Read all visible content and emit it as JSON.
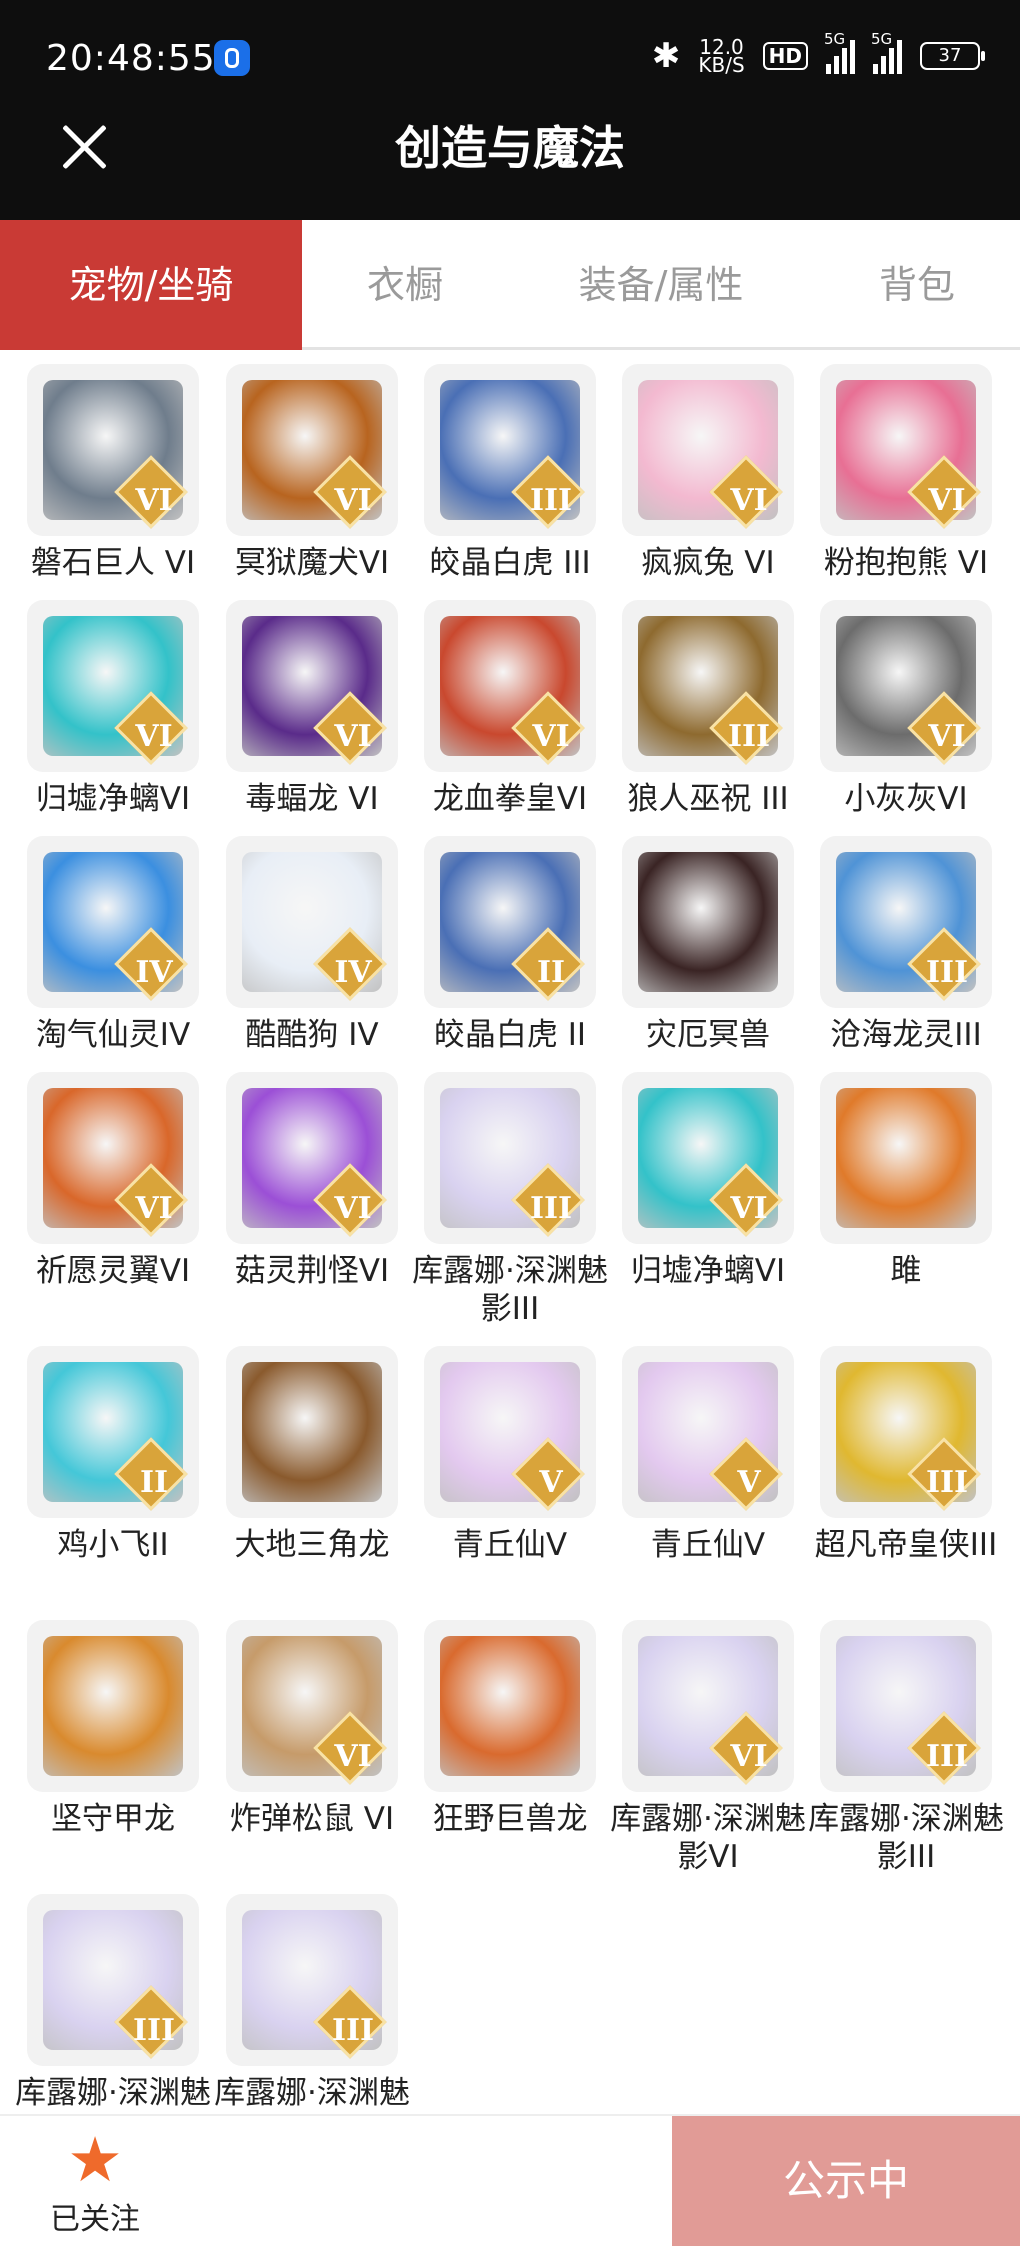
{
  "status_bar": {
    "time": "20:48:55",
    "speed_value": "12.0",
    "speed_unit": "KB/S",
    "hd_label": "HD",
    "network_1": "5G",
    "network_2": "5G",
    "battery": "37"
  },
  "header": {
    "title": "创造与魔法"
  },
  "tabs": [
    {
      "label": "宠物/坐骑",
      "active": true
    },
    {
      "label": "衣橱",
      "active": false
    },
    {
      "label": "装备/属性",
      "active": false
    },
    {
      "label": "背包",
      "active": false
    }
  ],
  "items": [
    {
      "name": "磐石巨人 VI",
      "badge": "VI"
    },
    {
      "name": "冥狱魔犬VI",
      "badge": "VI"
    },
    {
      "name": "皎晶白虎 III",
      "badge": "III"
    },
    {
      "name": "疯疯兔 VI",
      "badge": "VI"
    },
    {
      "name": "粉抱抱熊 VI",
      "badge": "VI"
    },
    {
      "name": "归墟净螭VI",
      "badge": "VI"
    },
    {
      "name": "毒蝠龙 VI",
      "badge": "VI"
    },
    {
      "name": "龙血拳皇VI",
      "badge": "VI"
    },
    {
      "name": "狼人巫祝 III",
      "badge": "III"
    },
    {
      "name": "小灰灰VI",
      "badge": "VI"
    },
    {
      "name": "淘气仙灵IV",
      "badge": "IV"
    },
    {
      "name": "酷酷狗 IV",
      "badge": "IV"
    },
    {
      "name": "皎晶白虎 II",
      "badge": "II"
    },
    {
      "name": "灾厄冥兽",
      "badge": ""
    },
    {
      "name": "沧海龙灵III",
      "badge": "III"
    },
    {
      "name": "祈愿灵翼VI",
      "badge": "VI"
    },
    {
      "name": "菇灵荆怪VI",
      "badge": "VI"
    },
    {
      "name": "库露娜·深渊魅影III",
      "badge": "III"
    },
    {
      "name": "归墟净螭VI",
      "badge": "VI"
    },
    {
      "name": "雎",
      "badge": ""
    },
    {
      "name": "鸡小飞II",
      "badge": "II"
    },
    {
      "name": "大地三角龙",
      "badge": ""
    },
    {
      "name": "青丘仙V",
      "badge": "V"
    },
    {
      "name": "青丘仙V",
      "badge": "V"
    },
    {
      "name": "超凡帝皇侠III",
      "badge": "III"
    },
    {
      "name": "坚守甲龙",
      "badge": ""
    },
    {
      "name": "炸弹松鼠 VI",
      "badge": "VI"
    },
    {
      "name": "狂野巨兽龙",
      "badge": ""
    },
    {
      "name": "库露娜·深渊魅影VI",
      "badge": "VI"
    },
    {
      "name": "库露娜·深渊魅影III",
      "badge": "III"
    },
    {
      "name": "库露娜·深渊魅影",
      "badge": "III"
    },
    {
      "name": "库露娜·深渊魅影",
      "badge": "III"
    }
  ],
  "colors": {
    "accent": "#c93a35",
    "badge": "#d9a43a",
    "publish_button": "#e19b96",
    "star": "#ef6a2b",
    "art": [
      "#6f7d8c",
      "#b8641f",
      "#4a6fb5",
      "#f3b9d0",
      "#e86f94",
      "#33c2c9",
      "#5a2b8a",
      "#c9482e",
      "#8e6a2f",
      "#6c6c6c",
      "#3b8fe0",
      "#e8eef6",
      "#4a6fb5",
      "#3a2424",
      "#4f93d6",
      "#d9672a",
      "#9b4fd6",
      "#d9d2f0",
      "#33c2c9",
      "#e07a2a",
      "#44c7d8",
      "#8a5a2d",
      "#e3c9ef",
      "#e3c9ef",
      "#e0b830",
      "#d98a2e",
      "#c69b6a",
      "#d96a2e",
      "#d9d2f0",
      "#d9d2f0",
      "#d9d2f0",
      "#d9d2f0"
    ]
  },
  "bottom": {
    "follow_label": "已关注",
    "publish_label": "公示中"
  }
}
